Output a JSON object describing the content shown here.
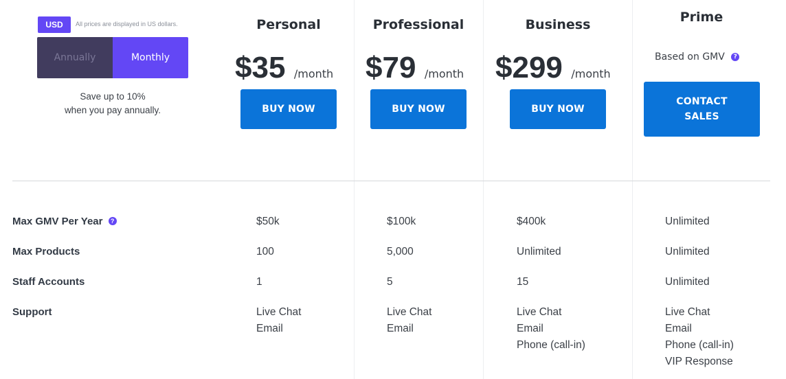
{
  "currency": {
    "badge": "USD",
    "note": "All prices are displayed in US dollars."
  },
  "billing_toggle": {
    "options": [
      "Annually",
      "Monthly"
    ],
    "selected": "Monthly"
  },
  "save_note": {
    "line1": "Save up to 10%",
    "line2": "when you pay annually."
  },
  "plans": [
    {
      "name": "Personal",
      "price": "$35",
      "period": "/month",
      "cta": "BUY NOW"
    },
    {
      "name": "Professional",
      "price": "$79",
      "period": "/month",
      "cta": "BUY NOW"
    },
    {
      "name": "Business",
      "price": "$299",
      "period": "/month",
      "cta": "BUY NOW"
    },
    {
      "name": "Prime",
      "pricing_note": "Based on GMV",
      "cta_line1": "CONTACT",
      "cta_line2": "SALES"
    }
  ],
  "features": [
    {
      "label": "Max GMV Per Year",
      "values": [
        "$50k",
        "$100k",
        "$400k",
        "Unlimited"
      ]
    },
    {
      "label": "Max Products",
      "values": [
        "100",
        "5,000",
        "Unlimited",
        "Unlimited"
      ]
    },
    {
      "label": "Staff Accounts",
      "values": [
        "1",
        "5",
        "15",
        "Unlimited"
      ]
    },
    {
      "label": "Support",
      "values": [
        [
          "Live Chat",
          "Email"
        ],
        [
          "Live Chat",
          "Email"
        ],
        [
          "Live Chat",
          "Email",
          "Phone (call-in)"
        ],
        [
          "Live Chat",
          "Email",
          "Phone (call-in)",
          "VIP Response"
        ]
      ]
    }
  ],
  "colors": {
    "accent": "#6347f5",
    "button": "#0b74d9",
    "toggle_inactive": "#413c5e"
  }
}
